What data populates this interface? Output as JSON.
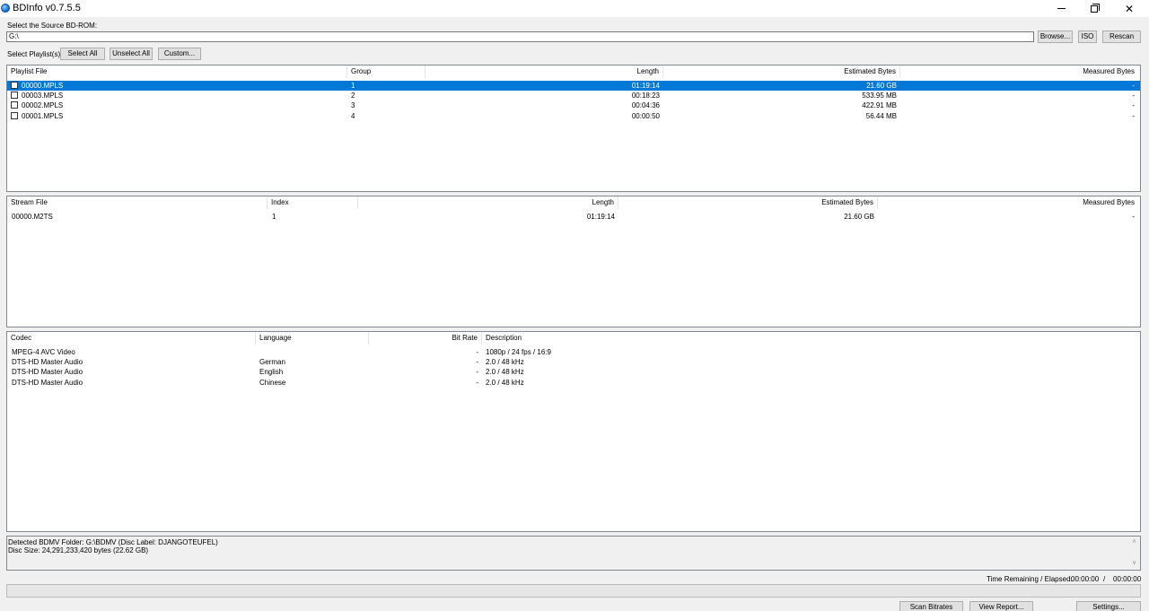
{
  "window": {
    "title": "BDInfo v0.7.5.5",
    "minimize": "—",
    "close": "✕"
  },
  "source": {
    "label": "Select the Source BD-ROM:",
    "value": "G:\\",
    "browse": "Browse...",
    "iso": "ISO",
    "rescan": "Rescan"
  },
  "playlists": {
    "label": "Select Playlist(s):",
    "select_all": "Select All",
    "unselect_all": "Unselect All",
    "custom": "Custom...",
    "headers": [
      "Playlist File",
      "Group",
      "Length",
      "Estimated Bytes",
      "Measured Bytes"
    ],
    "rows": [
      {
        "file": "00000.MPLS",
        "group": "1",
        "length": "01:19:14",
        "est": "21.60 GB",
        "meas": "-",
        "selected": true
      },
      {
        "file": "00003.MPLS",
        "group": "2",
        "length": "00:18:23",
        "est": "533.95 MB",
        "meas": "-"
      },
      {
        "file": "00002.MPLS",
        "group": "3",
        "length": "00:04:36",
        "est": "422.91 MB",
        "meas": "-"
      },
      {
        "file": "00001.MPLS",
        "group": "4",
        "length": "00:00:50",
        "est": "56.44 MB",
        "meas": "-"
      }
    ]
  },
  "streams": {
    "headers": [
      "Stream File",
      "Index",
      "Length",
      "Estimated Bytes",
      "Measured Bytes"
    ],
    "rows": [
      {
        "file": "00000.M2TS",
        "index": "1",
        "length": "01:19:14",
        "est": "21.60 GB",
        "meas": "-"
      }
    ]
  },
  "codecs": {
    "headers": [
      "Codec",
      "Language",
      "Bit Rate",
      "Description"
    ],
    "rows": [
      {
        "codec": "MPEG-4 AVC Video",
        "language": "",
        "bitrate": "-",
        "desc": "1080p / 24 fps / 16:9"
      },
      {
        "codec": "DTS-HD Master Audio",
        "language": "German",
        "bitrate": "-",
        "desc": "2.0 / 48 kHz"
      },
      {
        "codec": "DTS-HD Master Audio",
        "language": "English",
        "bitrate": "-",
        "desc": "2.0 / 48 kHz"
      },
      {
        "codec": "DTS-HD Master Audio",
        "language": "Chinese",
        "bitrate": "-",
        "desc": "2.0 / 48 kHz"
      }
    ]
  },
  "log": {
    "line1": "Detected BDMV Folder: G:\\BDMV (Disc Label: DJANGOTEUFEL)",
    "line2": "Disc Size: 24,291,233,420 bytes (22.62 GB)"
  },
  "time": {
    "label": "Time Remaining / Elapsed:",
    "remaining": "00:00:00",
    "sep": "/",
    "elapsed": "00:00:00"
  },
  "progress": 0,
  "footer": {
    "scan": "Scan Bitrates",
    "report": "View Report...",
    "settings": "Settings..."
  },
  "colors": {
    "selection": "#0078d7"
  }
}
